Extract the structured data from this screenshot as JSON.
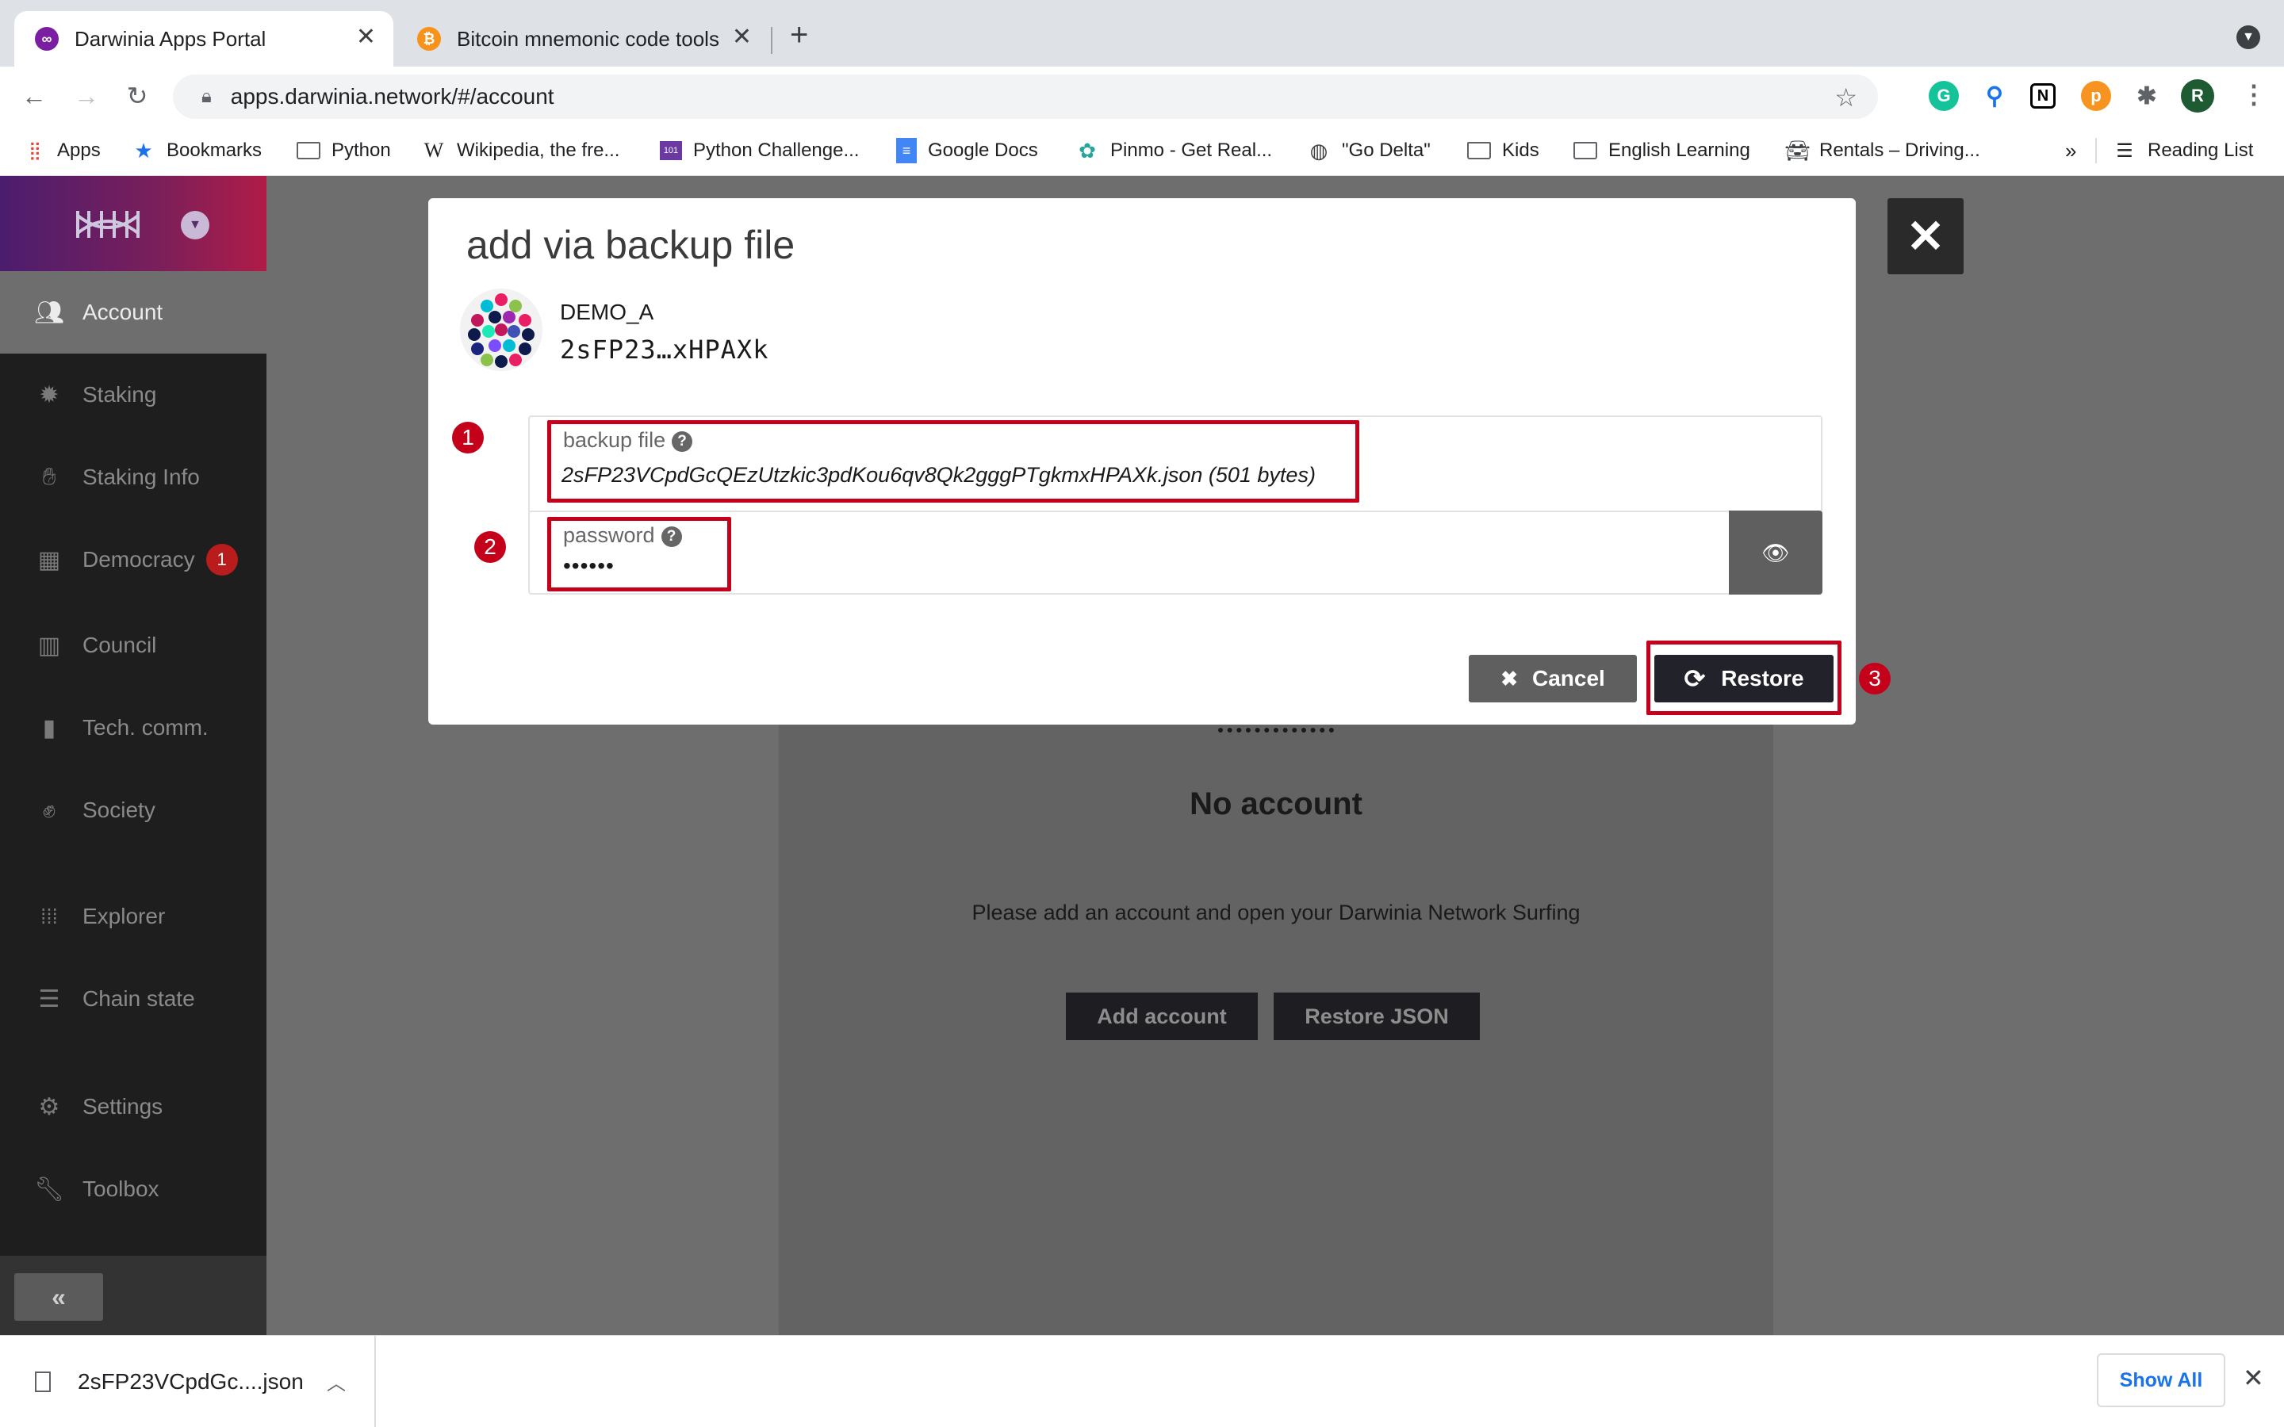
{
  "browser": {
    "tabs": [
      {
        "title": "Darwinia Apps Portal",
        "active": true
      },
      {
        "title": "Bitcoin mnemonic code tools",
        "active": false
      }
    ],
    "url": "apps.darwinia.network/#/account",
    "bookmarks": [
      {
        "label": "Apps",
        "icon": "apps-grid-icon"
      },
      {
        "label": "Bookmarks",
        "icon": "star-icon"
      },
      {
        "label": "Python",
        "icon": "folder-icon"
      },
      {
        "label": "Wikipedia, the fre...",
        "icon": "wikipedia-icon"
      },
      {
        "label": "Python Challenge...",
        "icon": "python-challenge-icon"
      },
      {
        "label": "Google Docs",
        "icon": "google-docs-icon"
      },
      {
        "label": "Pinmo - Get Real...",
        "icon": "pinmo-icon"
      },
      {
        "label": "\"Go Delta\"",
        "icon": "globe-icon"
      },
      {
        "label": "Kids",
        "icon": "folder-icon"
      },
      {
        "label": "English Learning",
        "icon": "folder-icon"
      },
      {
        "label": "Rentals – Driving...",
        "icon": "car-icon"
      }
    ],
    "more_bookmarks": "»",
    "reading_list": "Reading List",
    "profile_initial": "R"
  },
  "sidebar": {
    "items": [
      {
        "label": "Account",
        "icon": "users-icon",
        "active": true
      },
      {
        "label": "Staking",
        "icon": "gear-certificate-icon"
      },
      {
        "label": "Staking Info",
        "icon": "hand-icon"
      },
      {
        "label": "Democracy",
        "icon": "calendar-check-icon",
        "badge": "1"
      },
      {
        "label": "Council",
        "icon": "building-icon"
      },
      {
        "label": "Tech. comm.",
        "icon": "book-icon"
      },
      {
        "label": "Society",
        "icon": "hands-icon"
      },
      {
        "label": "Explorer",
        "icon": "dots-grid-icon"
      },
      {
        "label": "Chain state",
        "icon": "database-icon"
      },
      {
        "label": "Settings",
        "icon": "cogs-icon"
      },
      {
        "label": "Toolbox",
        "icon": "wrench-icon"
      }
    ],
    "collapse_label": "«"
  },
  "page": {
    "empty_title": "No account",
    "empty_text": "Please add an account and open your Darwinia Network Surfing",
    "add_account": "Add account",
    "restore_json": "Restore JSON"
  },
  "modal": {
    "title": "add via backup file",
    "account_name": "DEMO_A",
    "account_address": "2sFP23…xHPAXk",
    "backup_label": "backup file",
    "backup_value": "2sFP23VCpdGcQEzUtzkic3pdKou6qv8Qk2gggPTgkmxHPAXk.json (501 bytes)",
    "password_label": "password",
    "password_value": "••••••",
    "cancel_label": "Cancel",
    "restore_label": "Restore",
    "step_numbers": [
      "1",
      "2",
      "3"
    ]
  },
  "download_bar": {
    "file_name": "2sFP23VCpdGc....json",
    "show_all": "Show All"
  },
  "colors": {
    "annotation_red": "#c4001a",
    "sidebar_bg": "#1e1e1e",
    "brand_gradient": [
      "#4b1d6e",
      "#b01c48"
    ],
    "link_blue": "#1a73e8"
  }
}
